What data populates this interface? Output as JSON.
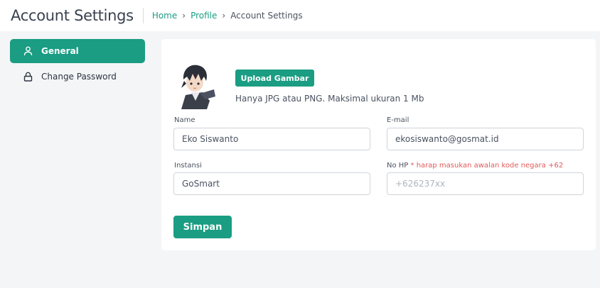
{
  "header": {
    "title": "Account Settings",
    "breadcrumb": [
      "Home",
      "Profile",
      "Account Settings"
    ],
    "separator": "›"
  },
  "sidebar": {
    "items": [
      {
        "label": "General",
        "icon": "user-icon",
        "active": true
      },
      {
        "label": "Change Password",
        "icon": "lock-icon",
        "active": false
      }
    ]
  },
  "profile": {
    "upload_label": "Upload Gambar",
    "hint": "Hanya JPG atau PNG. Maksimal ukuran 1 Mb"
  },
  "form": {
    "name": {
      "label": "Name",
      "value": "Eko Siswanto"
    },
    "email": {
      "label": "E-mail",
      "value": "ekosiswanto@gosmat.id"
    },
    "instansi": {
      "label": "Instansi",
      "value": "GoSmart"
    },
    "phone": {
      "label": "No HP",
      "note": "* harap masukan awalan kode negara +62",
      "value": "",
      "placeholder": "+626237xx"
    },
    "save_label": "Simpan"
  },
  "colors": {
    "accent": "#1a9d82",
    "required": "#e05a5a",
    "background": "#f4f5f7"
  }
}
